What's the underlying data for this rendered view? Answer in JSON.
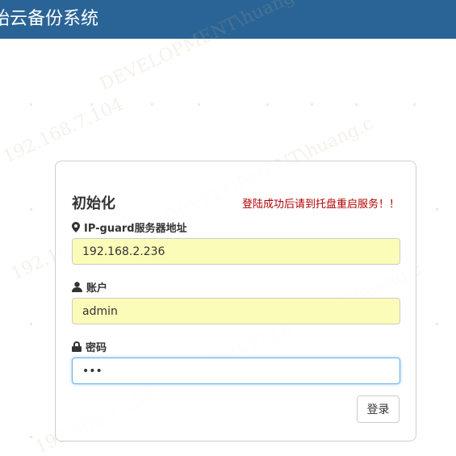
{
  "header": {
    "title": "始云备份系统"
  },
  "watermark": {
    "text": "DEVELOPMENT\\huang.c",
    "ip_fragment": "192.168.7.104"
  },
  "form": {
    "title": "初始化",
    "notice": "登陆成功后请到托盘重启服务！！",
    "server": {
      "icon": "map-marker-icon",
      "label": "IP-guard服务器地址",
      "value": "192.168.2.236"
    },
    "account": {
      "icon": "user-icon",
      "label": "账户",
      "value": "admin"
    },
    "password": {
      "icon": "lock-icon",
      "label": "密码",
      "value": "•••"
    },
    "submit_label": "登录"
  },
  "colors": {
    "header_bg": "#2a6496",
    "notice": "#b00000",
    "autofill_bg": "#fafcb8",
    "focus_border": "#66afe9"
  }
}
